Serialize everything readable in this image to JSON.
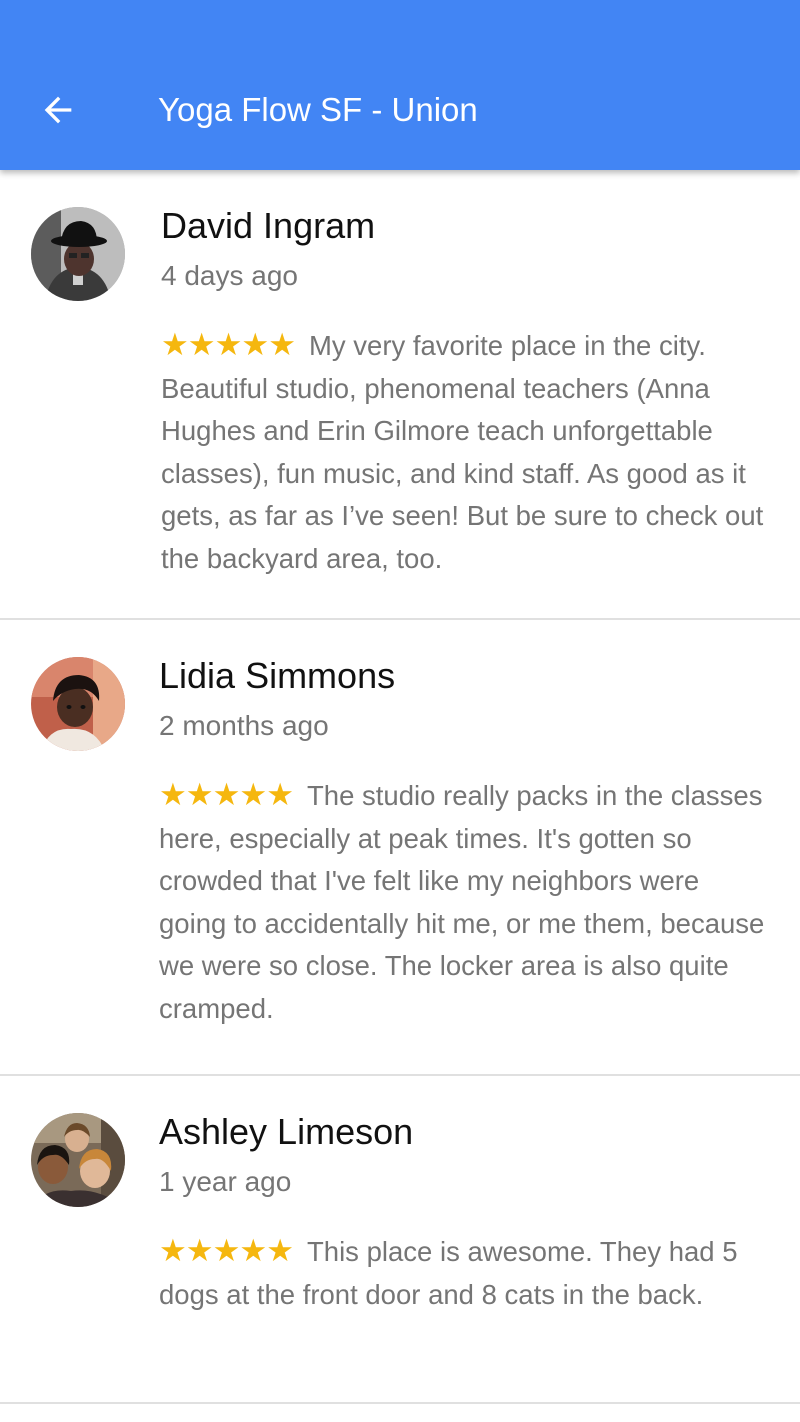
{
  "appbar": {
    "title": "Yoga Flow SF - Union",
    "back_icon": "arrow-left-icon",
    "color": "#4285f4"
  },
  "reviews": [
    {
      "name": "David Ingram",
      "time": "4 days ago",
      "rating": 5,
      "text": "My very favorite place in the city. Beautiful studio, phenomenal teachers (Anna Hughes and Erin Gilmore teach unforgettable classes), fun music, and kind staff. As good as it gets, as far as I’ve seen! But be sure to check out the backyard area, too."
    },
    {
      "name": "Lidia Simmons",
      "time": "2 months ago",
      "rating": 5,
      "text": "The studio really packs in the classes here, especially at peak times. It's gotten so crowded that I've felt like my neighbors were going to accidentally hit me, or me them, because we were so close. The locker area is also quite cramped."
    },
    {
      "name": "Ashley Limeson",
      "time": "1 year ago",
      "rating": 5,
      "text": "This place is awesome. They had 5 dogs at the front door and 8 cats in the back."
    }
  ],
  "colors": {
    "star": "#f5b70f",
    "secondary_text": "#757575",
    "primary_text": "#111111",
    "divider": "#e0e0e0"
  }
}
